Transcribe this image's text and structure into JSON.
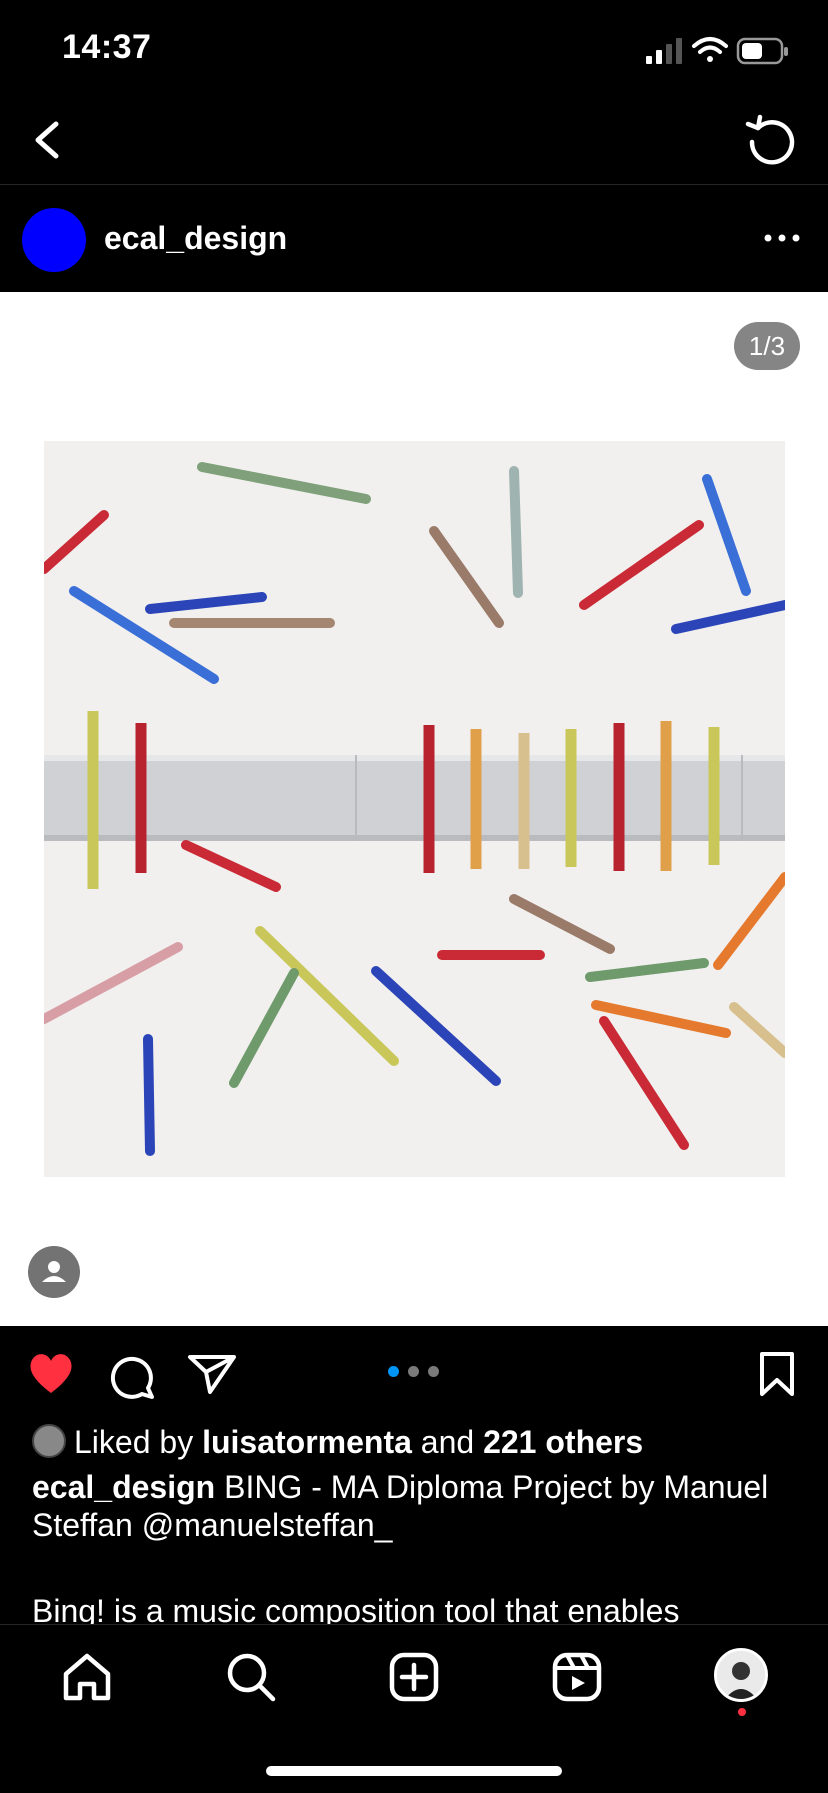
{
  "status_bar": {
    "time": "14:37"
  },
  "post": {
    "username": "ecal_design",
    "image_counter": "1/3",
    "carousel": {
      "total": 3,
      "active": 1
    },
    "likes": {
      "prefix": "Liked by ",
      "user": "luisatormenta",
      "middle": " and ",
      "others": "221 others"
    },
    "caption": {
      "author": "ecal_design",
      "text": " BING - MA Diploma Project by Manuel Steffan @manuelsteffan_",
      "continuation": "Bing! is a music composition tool that enables"
    },
    "liked": true
  },
  "colors": {
    "avatar": "#0000ff",
    "like": "#ff3040",
    "carousel_active": "#0095f6"
  },
  "icons": {
    "back": "chevron-left-icon",
    "refresh": "refresh-icon",
    "more": "more-horizontal-icon",
    "like": "heart-icon",
    "comment": "comment-icon",
    "share": "paper-plane-icon",
    "save": "bookmark-icon",
    "tabs": [
      "home-icon",
      "search-icon",
      "add-icon",
      "reels-icon",
      "profile-avatar"
    ]
  }
}
